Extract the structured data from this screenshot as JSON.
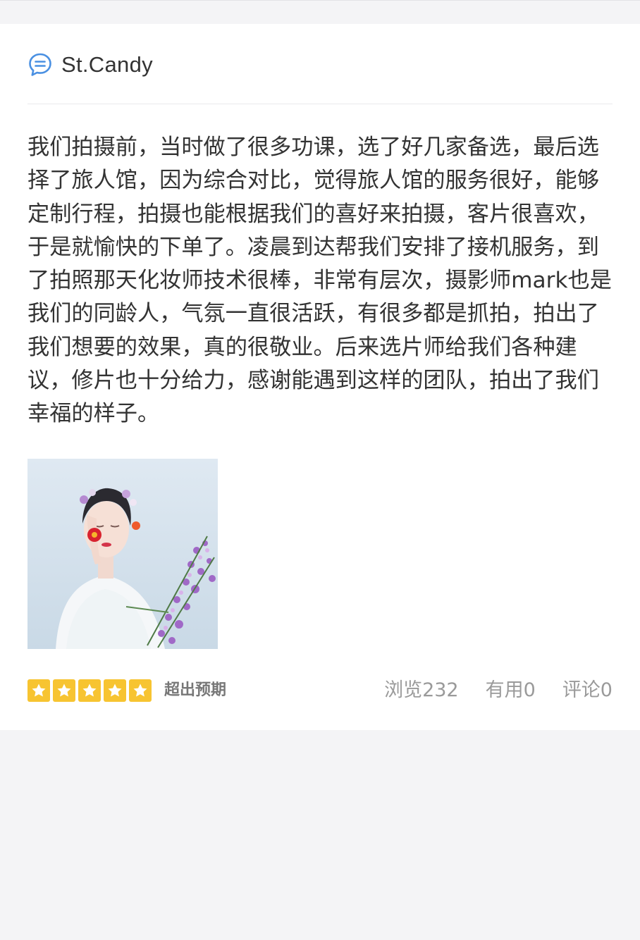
{
  "review": {
    "username": "St.Candy",
    "text": "我们拍摄前，当时做了很多功课，选了好几家备选，最后选择了旅人馆，因为综合对比，觉得旅人馆的服务很好，能够定制行程，拍摄也能根据我们的喜好来拍摄，客片很喜欢，于是就愉快的下单了。凌晨到达帮我们安排了接机服务，到了拍照那天化妆师技术很棒，非常有层次，摄影师mark也是我们的同龄人，气氛一直很活跃，有很多都是抓拍，拍出了我们想要的效果，真的很敬业。后来选片师给我们各种建议，修片也十分给力，感谢能遇到这样的团队，拍出了我们幸福的样子。",
    "photo_alt": "bride with flowers photo",
    "rating": 5,
    "rating_max": 5,
    "rating_label": "超出预期",
    "stats": {
      "views": "浏览232",
      "useful": "有用0",
      "comments": "评论0"
    }
  },
  "icons": {
    "header": "chat-bubble-icon",
    "rating": "star-icon"
  },
  "colors": {
    "accent_blue": "#4a90e2",
    "star": "#f7c431",
    "text": "#333333",
    "muted": "#9a9a9a",
    "background": "#f4f4f6"
  }
}
